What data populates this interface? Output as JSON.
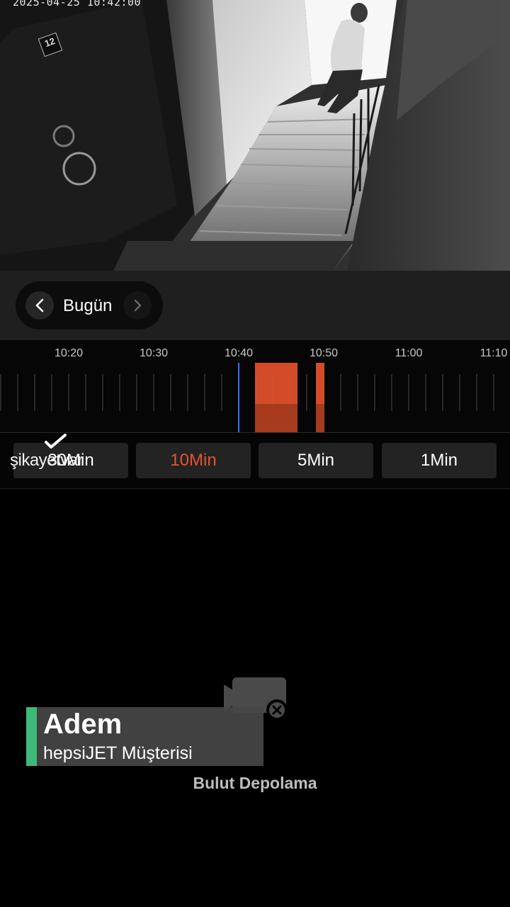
{
  "camera": {
    "timestamp": "2025-04-25 10:42:00",
    "door_number": "12"
  },
  "date_nav": {
    "label": "Bugün",
    "prev_icon": "chevron-left-icon",
    "next_icon": "chevron-right-icon"
  },
  "timeline": {
    "tick_labels": [
      "10:20",
      "10:30",
      "10:40",
      "10:50",
      "11:00",
      "11:10"
    ],
    "recorded_color": "#e5532d",
    "cursor_color": "#3a6dff",
    "cursor_time": "10:40"
  },
  "zoom": {
    "options": [
      "30Min",
      "10Min",
      "5Min",
      "1Min"
    ],
    "selected": "10Min",
    "accent": "#e5532d"
  },
  "watermark": "şikayetvar",
  "empty_state": {
    "icon": "video-off-icon",
    "label": "Bulut Depolama"
  },
  "overlay": {
    "name": "Adem",
    "subtitle": "hepsiJET Müşterisi",
    "accent": "#3fb97a"
  }
}
